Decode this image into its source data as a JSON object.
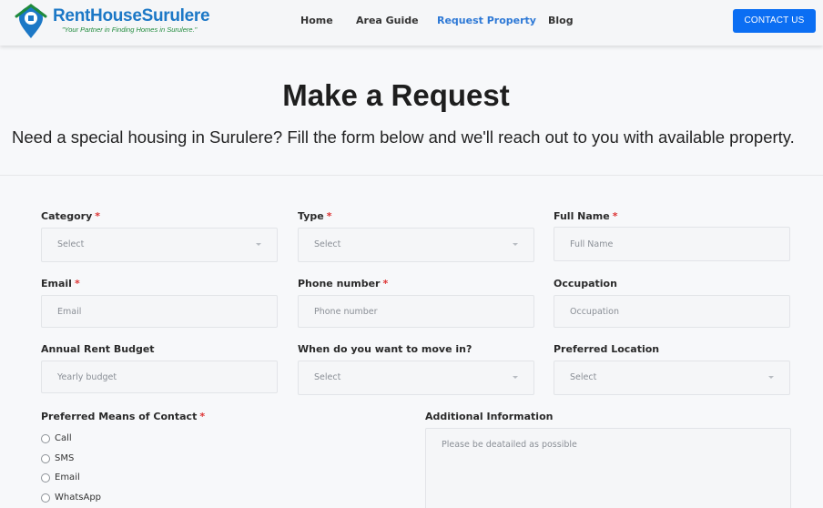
{
  "brand": {
    "name": "RentHouseSurulere",
    "tagline": "\"Your Partner in Finding Homes in Surulere.\""
  },
  "nav": {
    "items": [
      {
        "label": "Home"
      },
      {
        "label": "Area Guide"
      },
      {
        "label": "Request Property",
        "active": true
      },
      {
        "label": "Blog"
      }
    ],
    "contact_label": "CONTACT US"
  },
  "hero": {
    "title": "Make a Request",
    "subtitle": "Need a special housing in Surulere? Fill the form below and we'll reach out to you with available property."
  },
  "form": {
    "category": {
      "label": "Category",
      "required": "*",
      "value": "Select"
    },
    "type": {
      "label": "Type",
      "required": "*",
      "value": "Select"
    },
    "full_name": {
      "label": "Full Name",
      "required": "*",
      "placeholder": "Full Name"
    },
    "email": {
      "label": "Email",
      "required": "*",
      "placeholder": "Email"
    },
    "phone": {
      "label": "Phone number",
      "required": "*",
      "placeholder": "Phone number"
    },
    "occupation": {
      "label": "Occupation",
      "placeholder": "Occupation"
    },
    "budget": {
      "label": "Annual Rent Budget",
      "placeholder": "Yearly budget"
    },
    "move_in": {
      "label": "When do you want to move in?",
      "value": "Select"
    },
    "location": {
      "label": "Preferred Location",
      "value": "Select"
    },
    "contact_means": {
      "label": "Preferred Means of Contact",
      "required": "*",
      "options": [
        "Call",
        "SMS",
        "Email",
        "WhatsApp"
      ]
    },
    "additional": {
      "label": "Additional Information",
      "placeholder": "Please be deatailed as possible"
    }
  },
  "colors": {
    "primary": "#0b6ef3",
    "nav_active": "#2e79d6",
    "brand_blue": "#1c78c6",
    "brand_green": "#1f8a3c",
    "required": "#dd3333"
  }
}
